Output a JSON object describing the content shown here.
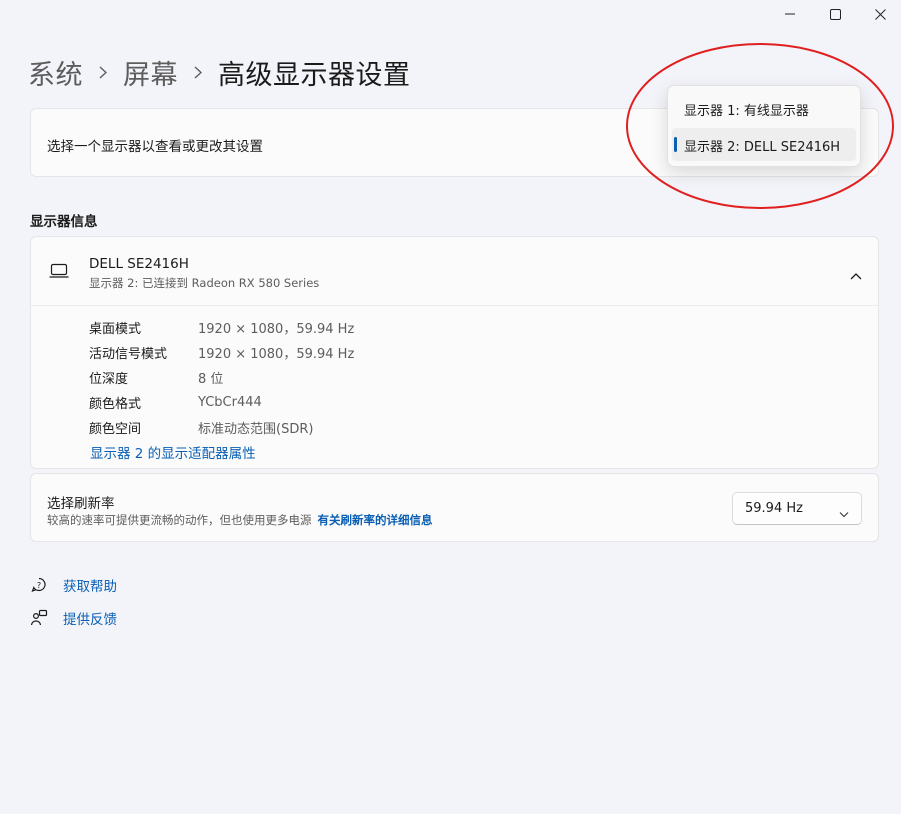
{
  "window": {
    "minimize_icon": "minimize-icon",
    "maximize_icon": "maximize-icon",
    "close_icon": "close-icon"
  },
  "breadcrumb": {
    "items": [
      "系统",
      "屏幕",
      "高级显示器设置"
    ]
  },
  "select_display": {
    "label": "选择一个显示器以查看或更改其设置"
  },
  "display_flyout": {
    "options": [
      "显示器 1: 有线显示器",
      "显示器 2: DELL SE2416H"
    ],
    "selected_index": 1
  },
  "display_info": {
    "section_title": "显示器信息",
    "monitor_name": "DELL SE2416H",
    "monitor_subtitle": "显示器 2: 已连接到 Radeon RX 580 Series",
    "rows": [
      {
        "key": "桌面模式",
        "value": "1920 × 1080，59.94 Hz"
      },
      {
        "key": "活动信号模式",
        "value": "1920 × 1080，59.94 Hz"
      },
      {
        "key": "位深度",
        "value": "8 位"
      },
      {
        "key": "颜色格式",
        "value": "YCbCr444"
      },
      {
        "key": "颜色空间",
        "value": "标准动态范围(SDR)"
      }
    ],
    "adapter_link": "显示器 2 的显示适配器属性"
  },
  "refresh_rate": {
    "title": "选择刷新率",
    "description": "较高的速率可提供更流畅的动作，但也使用更多电源",
    "link": "有关刷新率的详细信息",
    "selected_value": "59.94 Hz"
  },
  "footer": {
    "help": "获取帮助",
    "feedback": "提供反馈"
  },
  "colors": {
    "accent": "#0a5fb4",
    "annotation": "#e02020"
  }
}
